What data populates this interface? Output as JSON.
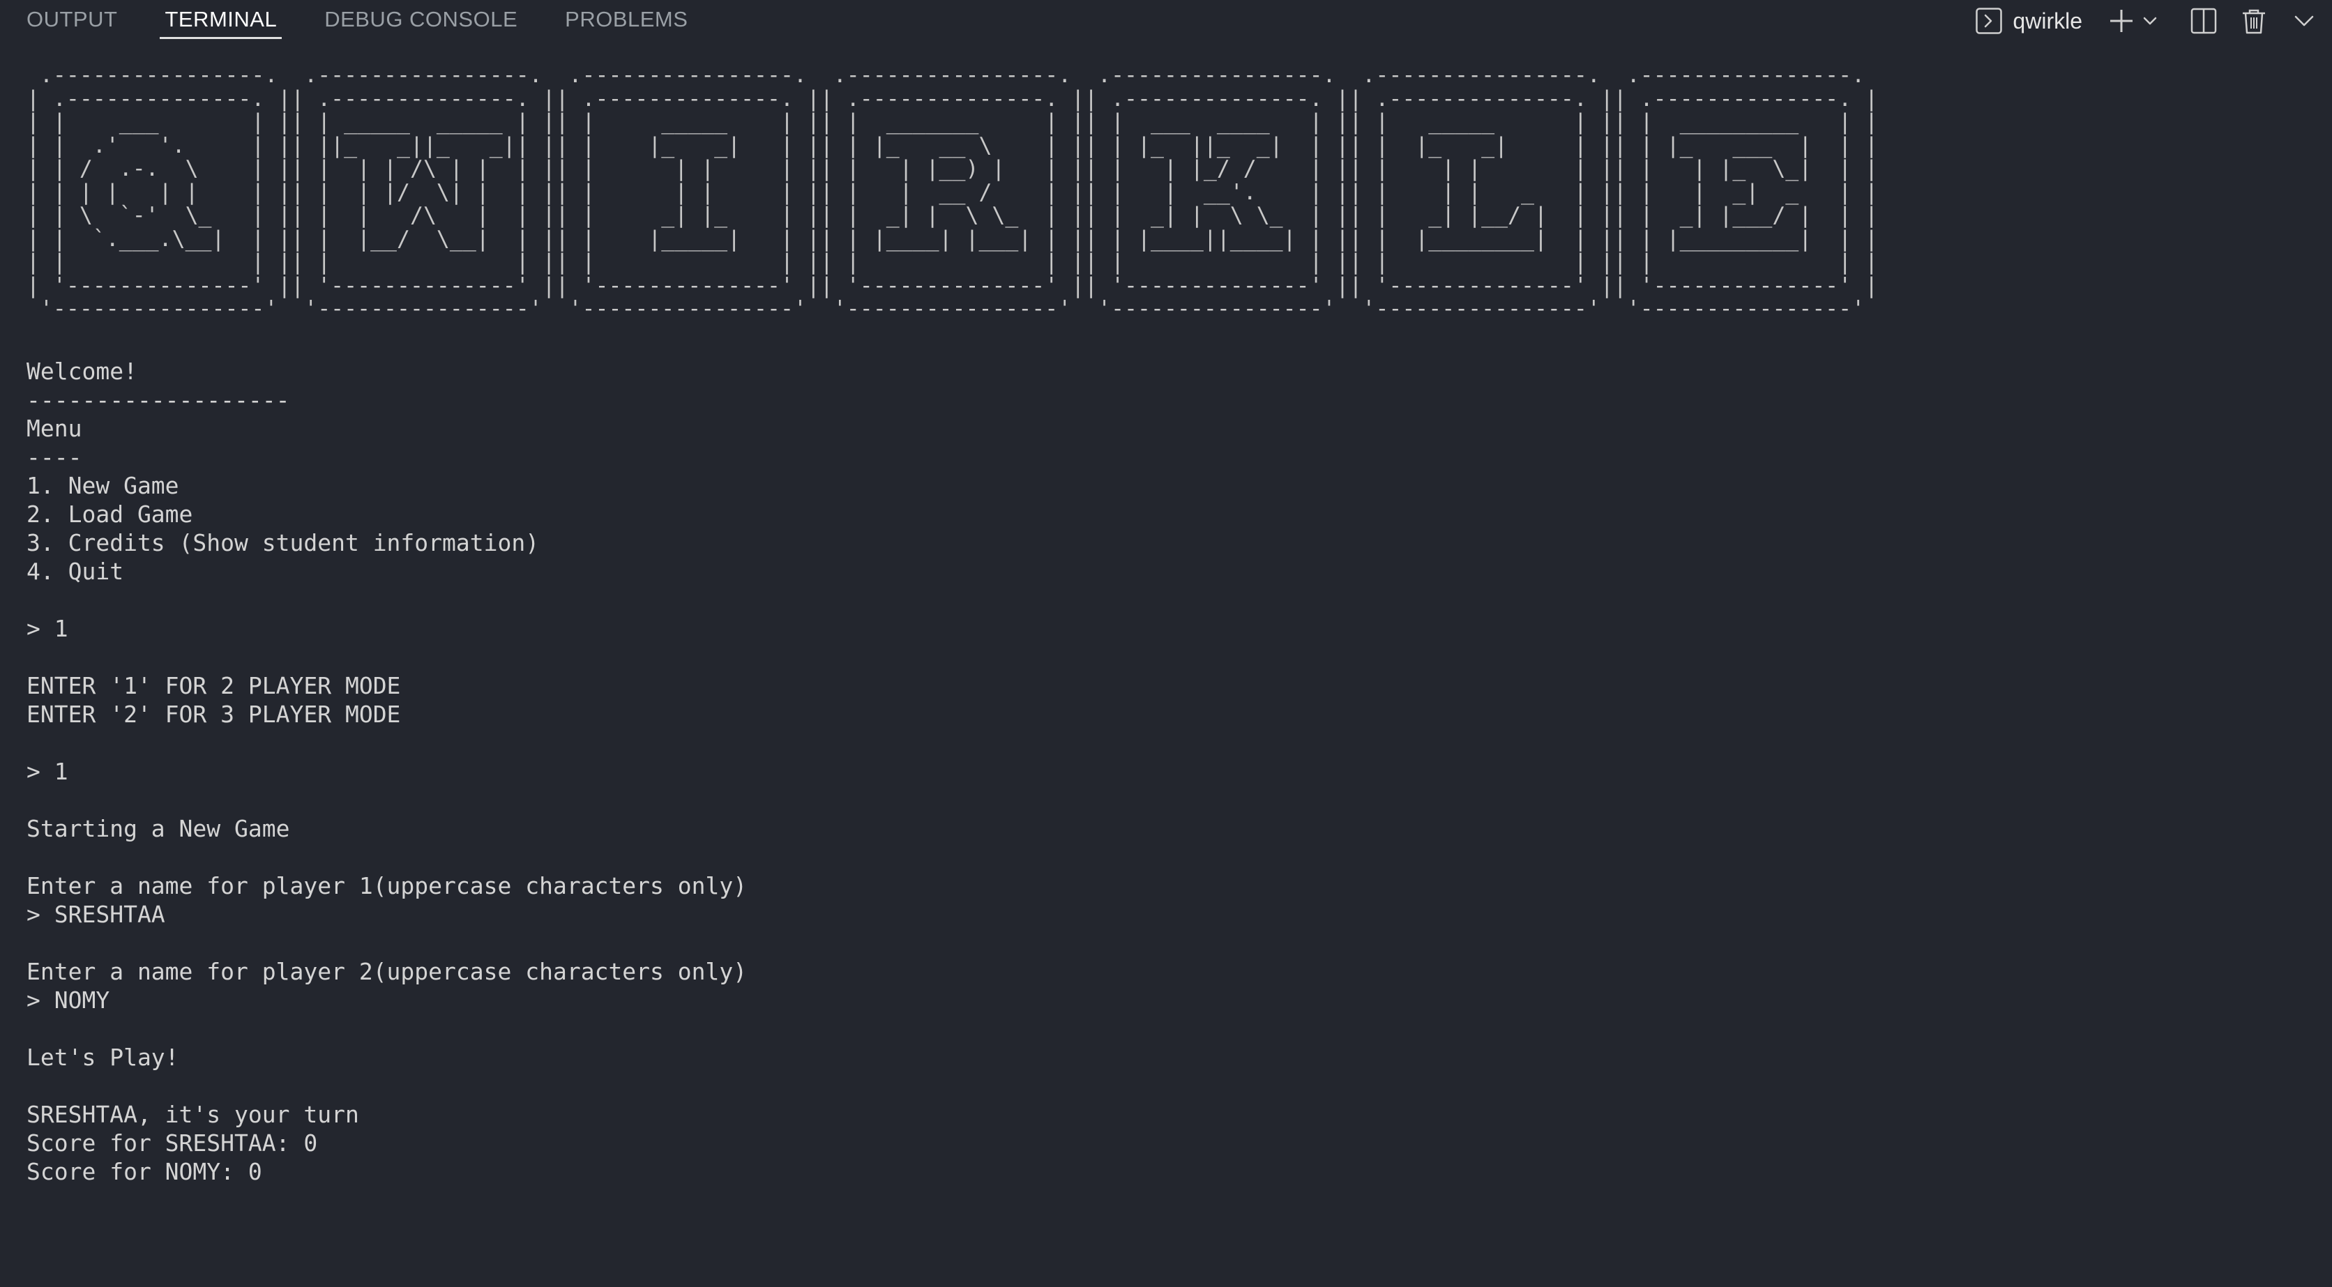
{
  "panel": {
    "tabs": [
      {
        "label": "OUTPUT",
        "active": false
      },
      {
        "label": "TERMINAL",
        "active": true
      },
      {
        "label": "DEBUG CONSOLE",
        "active": false
      },
      {
        "label": "PROBLEMS",
        "active": false
      }
    ],
    "terminal_name": "qwirkle",
    "icons": [
      "terminal-icon",
      "add-terminal-icon",
      "chevron-down-icon",
      "split-terminal-icon",
      "trash-icon",
      "panel-chevron-down-icon"
    ]
  },
  "colors": {
    "background": "#23262e",
    "text": "#d4d4d4",
    "tab_inactive": "#9aa0a6",
    "tab_active": "#ffffff"
  },
  "terminal": {
    "banner": " .----------------.  .----------------.  .----------------.  .----------------.  .----------------.  .----------------.  .----------------. \n| .--------------. || .--------------. || .--------------. || .--------------. || .--------------. || .--------------. || .--------------. |\n| |    ___       | || | _____  _____ | || |     _____    | || |  _______     | || |  ___  ____   | || |   _____      | || |  _________   | |\n| |  .'   '.     | || ||_   _||_   _|| || |    |_   _|   | || | |_   __ \\    | || | |_  ||_  _|  | || |  |_   _|     | || | |_   ___  |  | |\n| | /  .-.  \\    | || |  | | /\\ | |  | || |      | |     | || |   | |__) |   | || |   | |_/ /    | || |    | |       | || |   | |_  \\_|  | |\n| | | |   | |    | || |  | |/  \\| |  | || |      | |     | || |   |  __ /    | || |   |  __'.    | || |    | |   _   | || |   |  _|  _   | |\n| | \\  `-'  \\_   | || |  |   /\\   |  | || |     _| |_    | || |  _| |  \\ \\_  | || |  _| |  \\ \\_  | || |   _| |__/ |  | || |  _| |___/ |  | |\n| |  `.___.\\__|  | || |  |__/  \\__|  | || |    |_____|   | || | |____| |___| | || | |____||____| | || |  |________|  | || | |_________|  | |\n| |              | || |              | || |              | || |              | || |              | || |              | || |              | |\n| '--------------' || '--------------' || '--------------' || '--------------' || '--------------' || '--------------' || '--------------' |\n '----------------'  '----------------'  '----------------'  '----------------'  '----------------'  '----------------'  '----------------' ",
    "lines": [
      "Welcome!",
      "-------------------",
      "Menu",
      "----",
      "1. New Game",
      "2. Load Game",
      "3. Credits (Show student information)",
      "4. Quit",
      "",
      "> 1",
      "",
      "ENTER '1' FOR 2 PLAYER MODE",
      "ENTER '2' FOR 3 PLAYER MODE",
      "",
      "> 1",
      "",
      "Starting a New Game",
      "",
      "Enter a name for player 1(uppercase characters only)",
      "> SRESHTAA",
      "",
      "Enter a name for player 2(uppercase characters only)",
      "> NOMY",
      "",
      "Let's Play!",
      "",
      "SRESHTAA, it's your turn",
      "Score for SRESHTAA: 0",
      "Score for NOMY: 0"
    ]
  }
}
